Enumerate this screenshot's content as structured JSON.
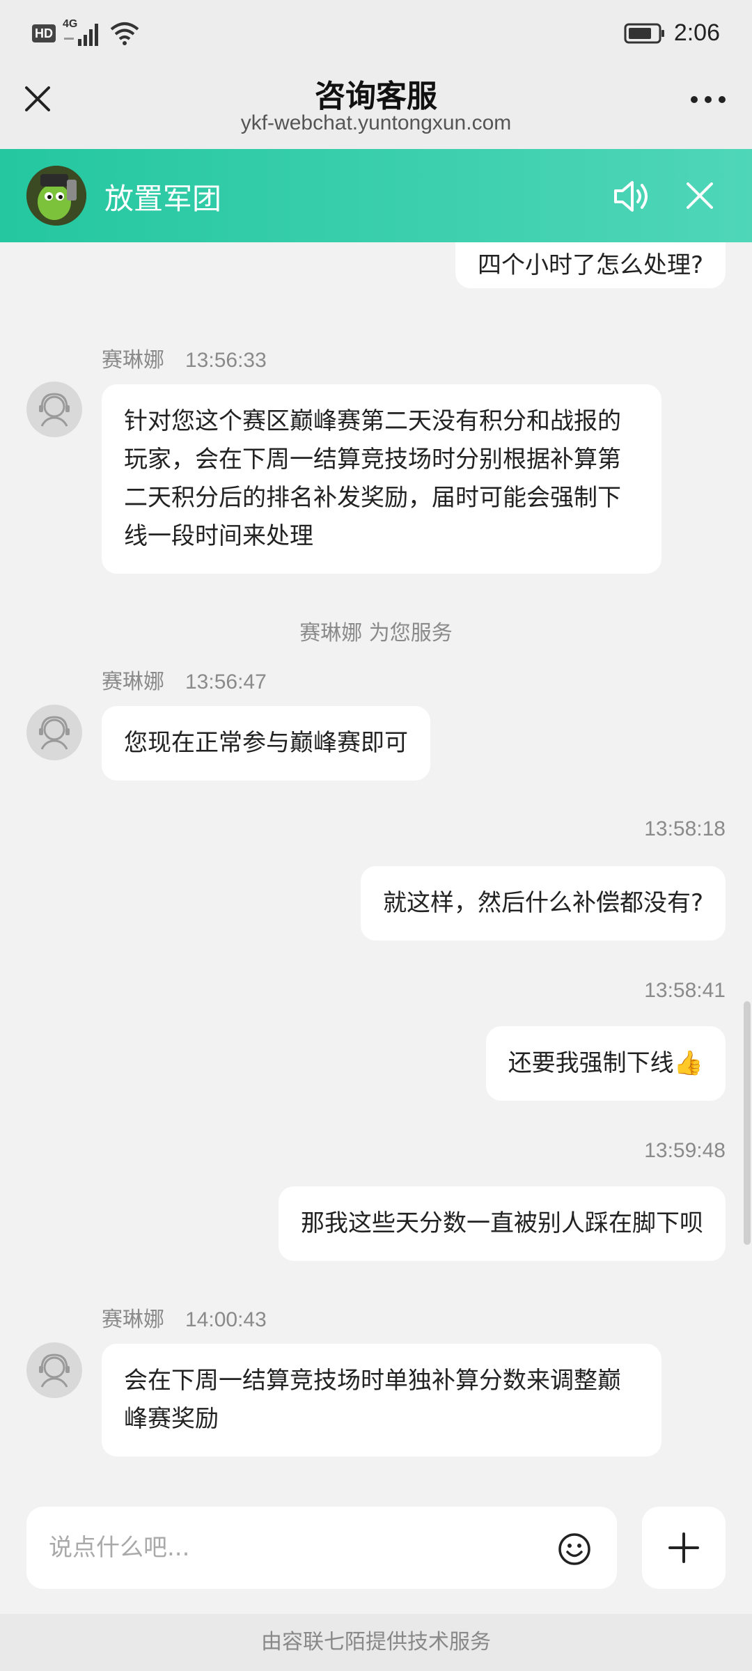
{
  "status_bar": {
    "hd_label": "HD",
    "network_label": "4G",
    "time": "2:06"
  },
  "title_bar": {
    "title": "咨询客服",
    "url": "ykf-webchat.yuntongxun.com"
  },
  "app_header": {
    "name": "放置军团",
    "accent_color": "#2ccaa5"
  },
  "chat": {
    "messages": [
      {
        "side": "right",
        "text": "四个小时了怎么处理?"
      },
      {
        "side": "left",
        "sender": "赛琳娜",
        "time": "13:56:33",
        "text": "针对您这个赛区巅峰赛第二天没有积分和战报的玩家，会在下周一结算竞技场时分别根据补算第二天积分后的排名补发奖励，届时可能会强制下线一段时间来处理"
      },
      {
        "side": "system",
        "text": "赛琳娜 为您服务"
      },
      {
        "side": "left",
        "sender": "赛琳娜",
        "time": "13:56:47",
        "text": "您现在正常参与巅峰赛即可"
      },
      {
        "side": "right",
        "time": "13:58:18",
        "text": "就这样，然后什么补偿都没有?"
      },
      {
        "side": "right",
        "time": "13:58:41",
        "text": "还要我强制下线👍"
      },
      {
        "side": "right",
        "time": "13:59:48",
        "text": "那我这些天分数一直被别人踩在脚下呗"
      },
      {
        "side": "left",
        "sender": "赛琳娜",
        "time": "14:00:43",
        "text": "会在下周一结算竞技场时单独补算分数来调整巅峰赛奖励"
      }
    ]
  },
  "input": {
    "placeholder": "说点什么吧..."
  },
  "footer": {
    "text": "由容联七陌提供技术服务"
  }
}
